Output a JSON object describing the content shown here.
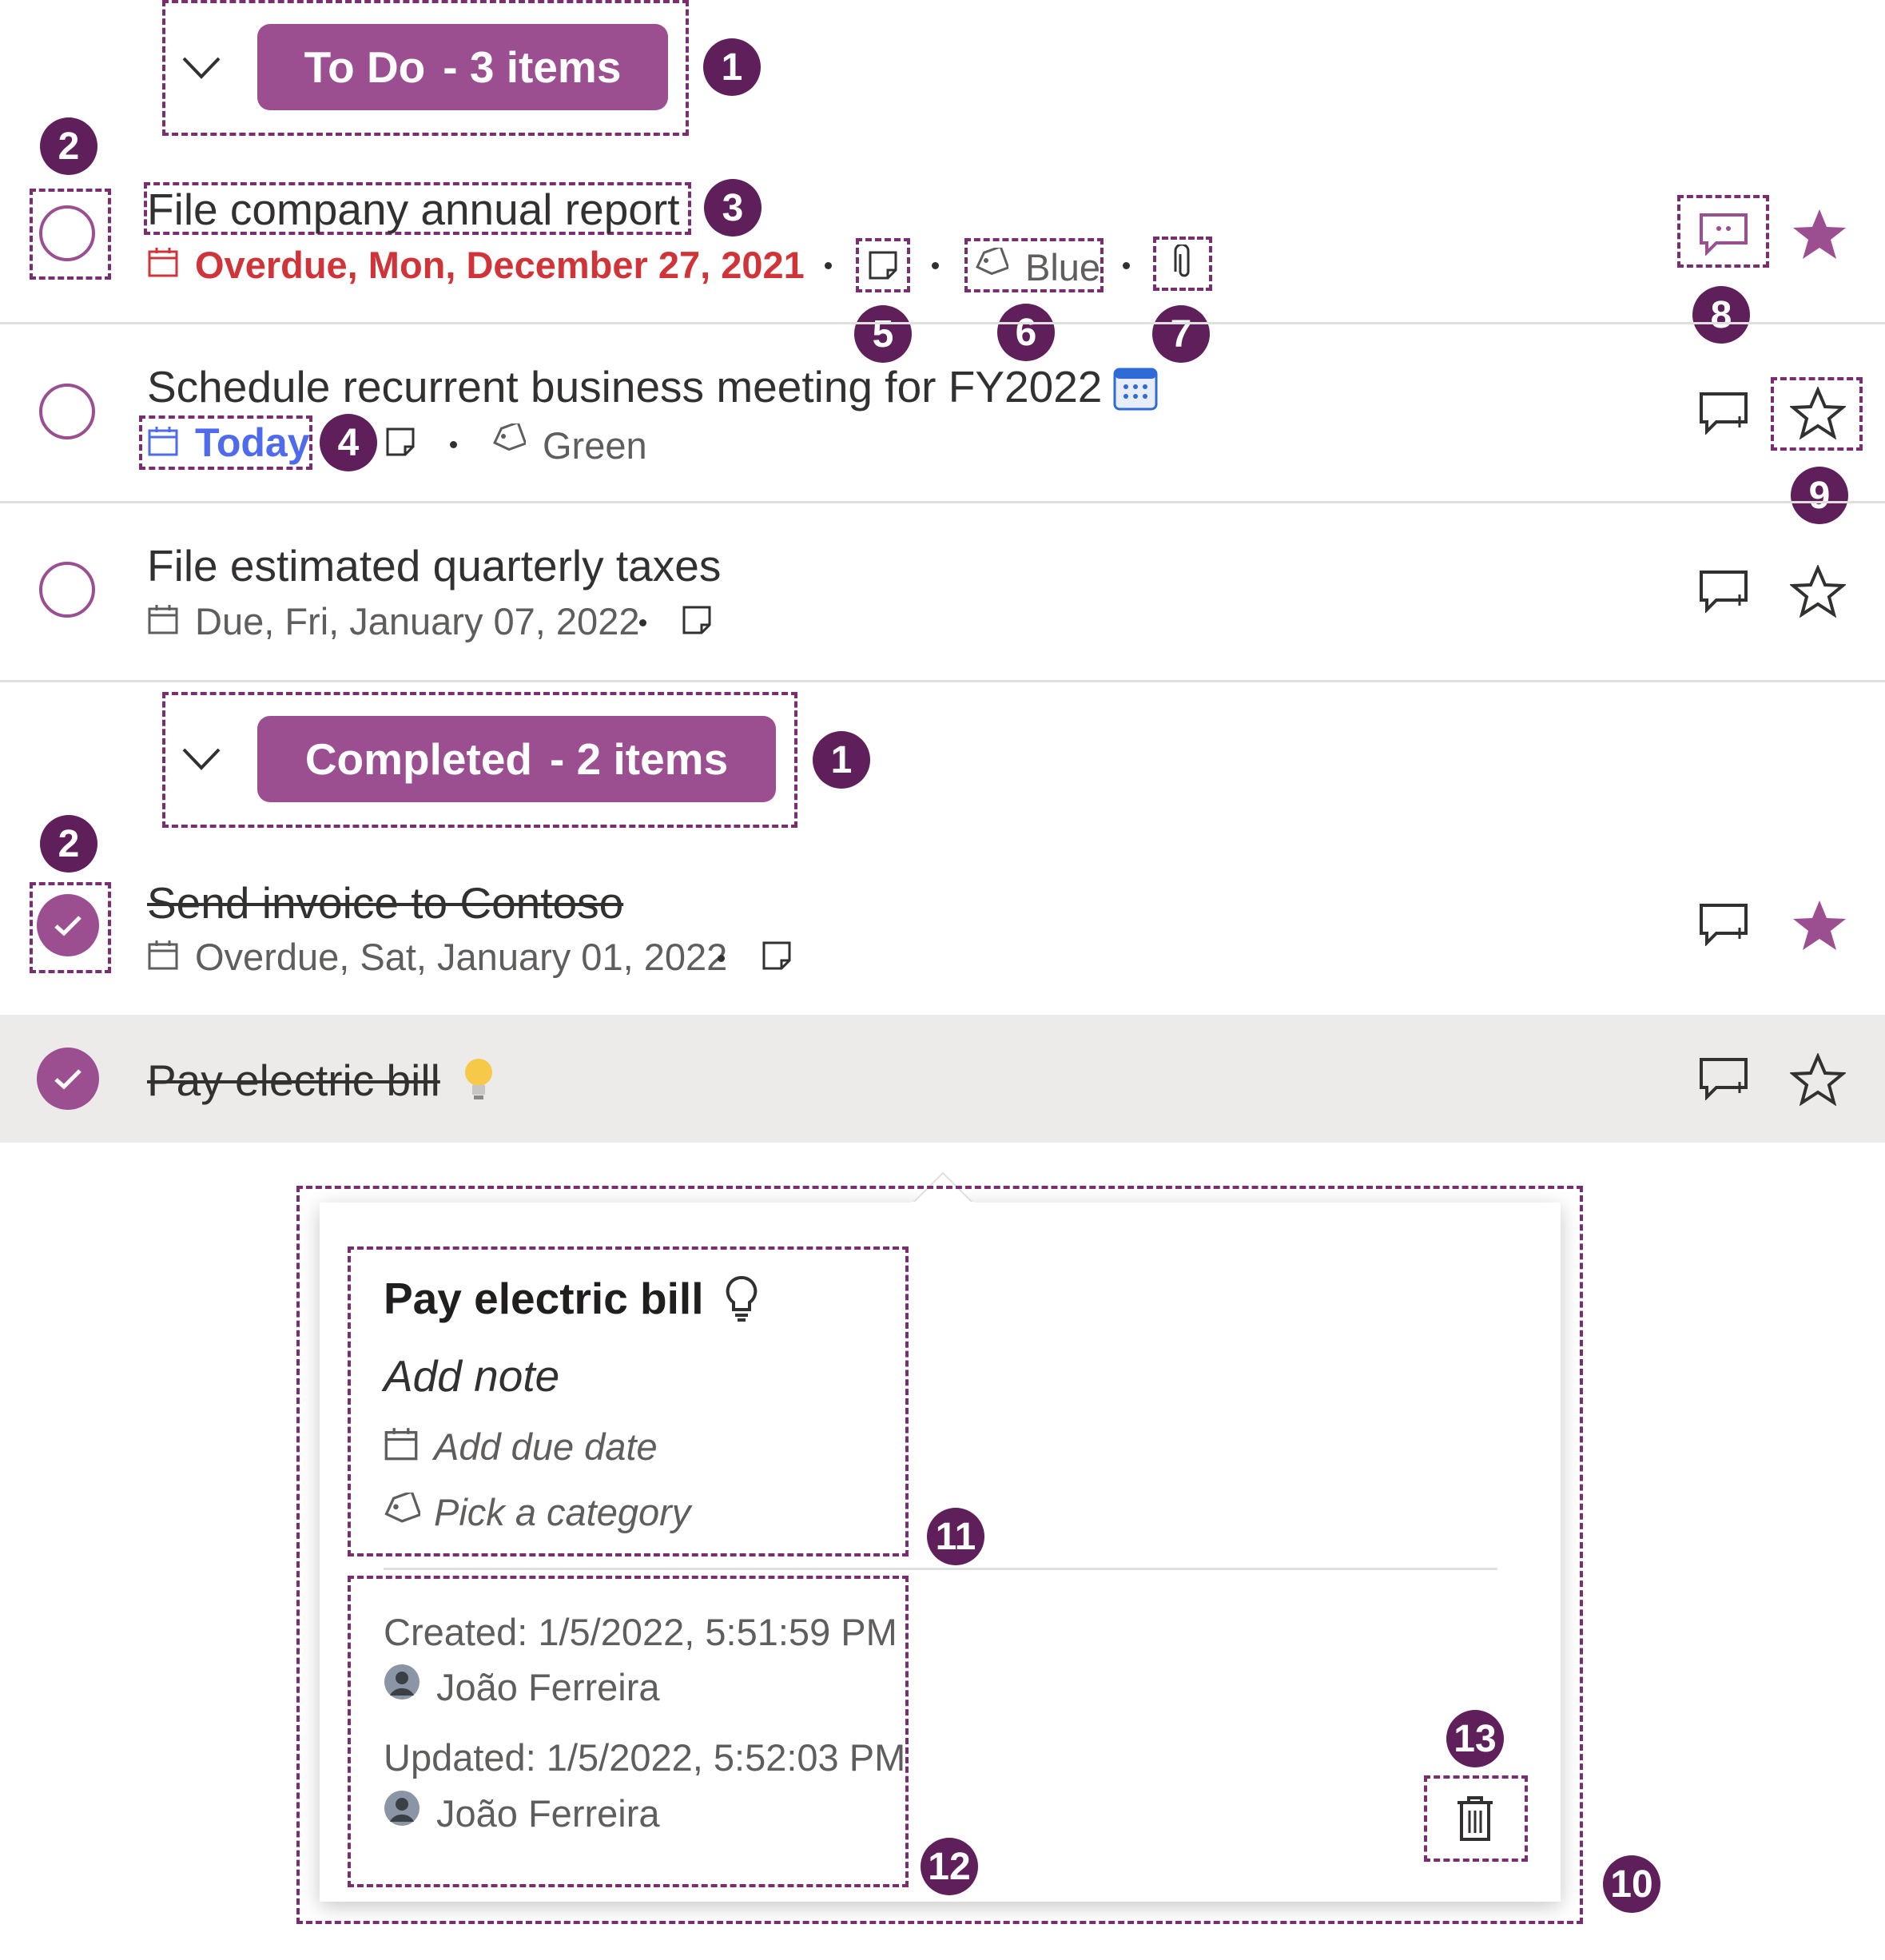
{
  "todo_group": {
    "label": "To Do",
    "count": "- 3 items"
  },
  "completed_group": {
    "label": "Completed",
    "count": "- 2 items"
  },
  "callouts": {
    "c1": "1",
    "c2": "2",
    "c3": "3",
    "c4": "4",
    "c5": "5",
    "c6": "6",
    "c7": "7",
    "c8": "8",
    "c9": "9",
    "c10": "10",
    "c11": "11",
    "c12": "12",
    "c13": "13"
  },
  "tasks": [
    {
      "title": "File company annual report",
      "due": "Overdue, Mon, December 27, 2021",
      "category": "Blue",
      "starred": true
    },
    {
      "title": "Schedule recurrent business meeting for FY2022",
      "due": "Today",
      "category": "Green",
      "starred": false
    },
    {
      "title": "File estimated quarterly taxes",
      "due": "Due, Fri, January 07, 2022",
      "starred": false
    }
  ],
  "completed_tasks": [
    {
      "title": "Send invoice to Contoso",
      "due": "Overdue, Sat, January 01, 2022",
      "starred": true
    },
    {
      "title": "Pay electric bill",
      "starred": false
    }
  ],
  "detail": {
    "title": "Pay electric bill",
    "note_placeholder": "Add note",
    "due_placeholder": "Add due date",
    "category_placeholder": "Pick a category",
    "created": "Created: 1/5/2022, 5:51:59 PM",
    "created_by": "João Ferreira",
    "updated": "Updated: 1/5/2022, 5:52:03 PM",
    "updated_by": "João Ferreira"
  },
  "colors": {
    "accent": "#9b4f91",
    "callout": "#5f1f5b",
    "overdue": "#d13438",
    "today": "#4f6bed",
    "selected_row": "#edebe9"
  }
}
